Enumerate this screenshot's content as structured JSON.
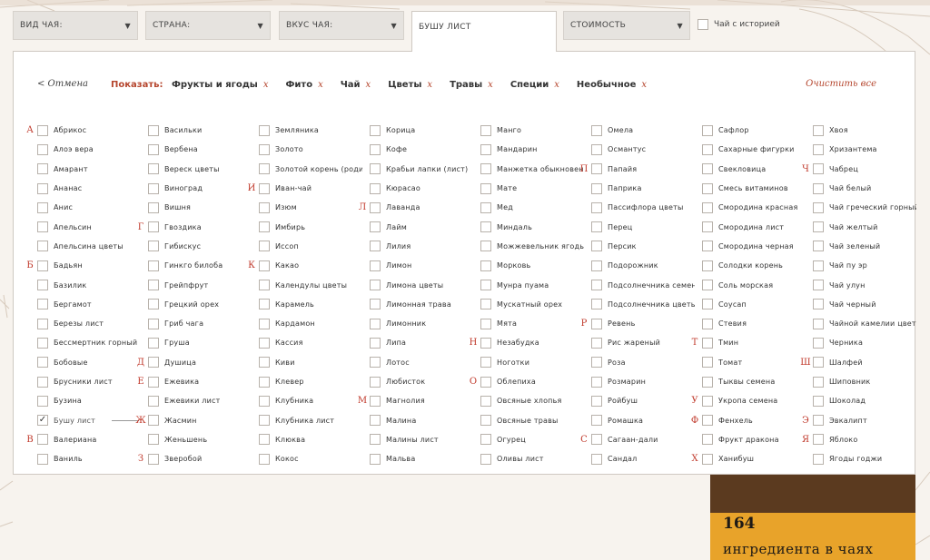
{
  "filters": {
    "tea_type": "ВИД ЧАЯ:",
    "country": "СТРАНА:",
    "taste": "ВКУС ЧАЯ:",
    "active_tab": "БУШУ ЛИСТ",
    "price": "СТОИМОСТЬ",
    "arrow": "▼",
    "history_label": "Чай с историей"
  },
  "panel": {
    "cancel": "< Отмена",
    "show_label": "Показать:",
    "chip_close": "x",
    "chips": [
      "Фрукты и ягоды",
      "Фито",
      "Чай",
      "Цветы",
      "Травы",
      "Специи",
      "Необычное"
    ],
    "clear_all": "Очистить все"
  },
  "columns": [
    [
      {
        "letter": "А",
        "label": "Абрикос"
      },
      {
        "label": "Алоэ вера"
      },
      {
        "label": "Амарант"
      },
      {
        "label": "Ананас"
      },
      {
        "label": "Анис"
      },
      {
        "label": "Апельсин"
      },
      {
        "label": "Апельсина цветы"
      },
      {
        "letter": "Б",
        "label": "Бадьян"
      },
      {
        "label": "Базилик"
      },
      {
        "label": "Бергамот"
      },
      {
        "label": "Березы лист"
      },
      {
        "label": "Бессмертник горный"
      },
      {
        "label": "Бобовые"
      },
      {
        "label": "Брусники лист"
      },
      {
        "label": "Бузина"
      },
      {
        "label": "Бушу лист",
        "checked": true
      },
      {
        "letter": "В",
        "label": "Валериана"
      },
      {
        "label": "Ваниль"
      }
    ],
    [
      {
        "label": "Васильки"
      },
      {
        "label": "Вербена"
      },
      {
        "label": "Вереск цветы"
      },
      {
        "label": "Виноград"
      },
      {
        "label": "Вишня"
      },
      {
        "letter": "Г",
        "label": "Гвоздика"
      },
      {
        "label": "Гибискус"
      },
      {
        "label": "Гинкго билоба"
      },
      {
        "label": "Грейпфрут"
      },
      {
        "label": "Грецкий орех"
      },
      {
        "label": "Гриб чага"
      },
      {
        "label": "Груша"
      },
      {
        "letter": "Д",
        "label": "Душица"
      },
      {
        "letter": "Е",
        "label": "Ежевика"
      },
      {
        "label": "Ежевики лист"
      },
      {
        "letter": "Ж",
        "label": "Жасмин"
      },
      {
        "label": "Женьшень"
      },
      {
        "letter": "З",
        "label": "Зверобой"
      }
    ],
    [
      {
        "label": "Земляника"
      },
      {
        "label": "Золото"
      },
      {
        "label": "Золотой корень (родиола)"
      },
      {
        "letter": "И",
        "label": "Иван-чай"
      },
      {
        "label": "Изюм"
      },
      {
        "label": "Имбирь"
      },
      {
        "label": "Иссоп"
      },
      {
        "letter": "К",
        "label": "Какао"
      },
      {
        "label": "Календулы цветы"
      },
      {
        "label": "Карамель"
      },
      {
        "label": "Кардамон"
      },
      {
        "label": "Кассия"
      },
      {
        "label": "Киви"
      },
      {
        "label": "Клевер"
      },
      {
        "label": "Клубника"
      },
      {
        "label": "Клубника лист"
      },
      {
        "label": "Клюква"
      },
      {
        "label": "Кокос"
      }
    ],
    [
      {
        "label": "Корица"
      },
      {
        "label": "Кофе"
      },
      {
        "label": "Крабьи лапки (лист)"
      },
      {
        "label": "Кюрасао"
      },
      {
        "letter": "Л",
        "label": "Лаванда"
      },
      {
        "label": "Лайм"
      },
      {
        "label": "Лилия"
      },
      {
        "label": "Лимон"
      },
      {
        "label": "Лимона цветы"
      },
      {
        "label": "Лимонная трава"
      },
      {
        "label": "Лимонник"
      },
      {
        "label": "Липа"
      },
      {
        "label": "Лотос"
      },
      {
        "label": "Любисток"
      },
      {
        "letter": "М",
        "label": "Магнолия"
      },
      {
        "label": "Малина"
      },
      {
        "label": "Малины лист"
      },
      {
        "label": "Мальва"
      }
    ],
    [
      {
        "label": "Манго"
      },
      {
        "label": "Мандарин"
      },
      {
        "label": "Манжетка обыкновенная"
      },
      {
        "label": "Мате"
      },
      {
        "label": "Мед"
      },
      {
        "label": "Миндаль"
      },
      {
        "label": "Можжевельник ягоды"
      },
      {
        "label": "Морковь"
      },
      {
        "label": "Мунра пуама"
      },
      {
        "label": "Мускатный орех"
      },
      {
        "label": "Мята"
      },
      {
        "letter": "Н",
        "label": "Незабудка"
      },
      {
        "label": "Ноготки"
      },
      {
        "letter": "О",
        "label": "Облепиха"
      },
      {
        "label": "Овсяные хлопья"
      },
      {
        "label": "Овсяные травы"
      },
      {
        "label": "Огурец"
      },
      {
        "label": "Оливы лист"
      }
    ],
    [
      {
        "label": "Омела"
      },
      {
        "label": "Османтус"
      },
      {
        "letter": "П",
        "label": "Папайя"
      },
      {
        "label": "Паприка"
      },
      {
        "label": "Пассифлора цветы"
      },
      {
        "label": "Перец"
      },
      {
        "label": "Персик"
      },
      {
        "label": "Подорожник"
      },
      {
        "label": "Подсолнечника семена"
      },
      {
        "label": "Подсолнечника цветы"
      },
      {
        "letter": "Р",
        "label": "Ревень"
      },
      {
        "label": "Рис жареный"
      },
      {
        "label": "Роза"
      },
      {
        "label": "Розмарин"
      },
      {
        "label": "Ройбуш"
      },
      {
        "label": "Ромашка"
      },
      {
        "letter": "С",
        "label": "Сагаан-дали"
      },
      {
        "label": "Сандал"
      }
    ],
    [
      {
        "label": "Сафлор"
      },
      {
        "label": "Сахарные фигурки"
      },
      {
        "label": "Свекловица"
      },
      {
        "label": "Смесь витаминов"
      },
      {
        "label": "Смородина красная"
      },
      {
        "label": "Смородина лист"
      },
      {
        "label": "Смородина черная"
      },
      {
        "label": "Солодки корень"
      },
      {
        "label": "Соль морская"
      },
      {
        "label": "Соусап"
      },
      {
        "label": "Стевия"
      },
      {
        "letter": "Т",
        "label": "Тмин"
      },
      {
        "label": "Томат"
      },
      {
        "label": "Тыквы семена"
      },
      {
        "letter": "У",
        "label": "Укропа семена"
      },
      {
        "letter": "Ф",
        "label": "Фенхель"
      },
      {
        "label": "Фрукт дракона"
      },
      {
        "letter": "Х",
        "label": "Ханибуш"
      }
    ],
    [
      {
        "label": "Хвоя"
      },
      {
        "label": "Хризантема"
      },
      {
        "letter": "Ч",
        "label": "Чабрец"
      },
      {
        "label": "Чай белый"
      },
      {
        "label": "Чай греческий горный"
      },
      {
        "label": "Чай желтый"
      },
      {
        "label": "Чай зеленый"
      },
      {
        "label": "Чай пу эр"
      },
      {
        "label": "Чай улун"
      },
      {
        "label": "Чай черный"
      },
      {
        "label": "Чайной камелии цветы"
      },
      {
        "label": "Черника"
      },
      {
        "letter": "Ш",
        "label": "Шалфей"
      },
      {
        "label": "Шиповник"
      },
      {
        "label": "Шоколад"
      },
      {
        "letter": "Э",
        "label": "Эвкалипт"
      },
      {
        "letter": "Я",
        "label": "Яблоко"
      },
      {
        "label": "Ягоды годжи"
      }
    ]
  ],
  "promo": {
    "number": "164",
    "text": "ингредиента в чаях"
  },
  "colors": {
    "accent": "#b5452d",
    "letter": "#c0392b",
    "promo_bg": "#e8a32a"
  }
}
